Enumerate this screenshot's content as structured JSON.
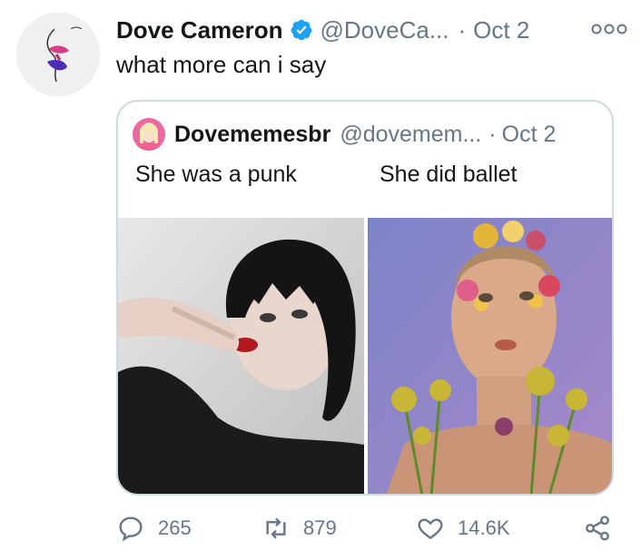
{
  "tweet": {
    "name": "Dove Cameron",
    "handle": "@DoveCa...",
    "dot": "·",
    "date": "Oct 2",
    "text": "what more can i say"
  },
  "quote": {
    "name": "Dovememesbr",
    "handle": "@dovemem...",
    "dot": "·",
    "date": "Oct 2",
    "caption_left": "She was a punk",
    "caption_right": "She did ballet"
  },
  "actions": {
    "replies": "265",
    "retweets": "879",
    "likes": "14.6K"
  },
  "colors": {
    "verified": "#1da1f2",
    "muted": "#657786",
    "border": "#cfd9de"
  }
}
